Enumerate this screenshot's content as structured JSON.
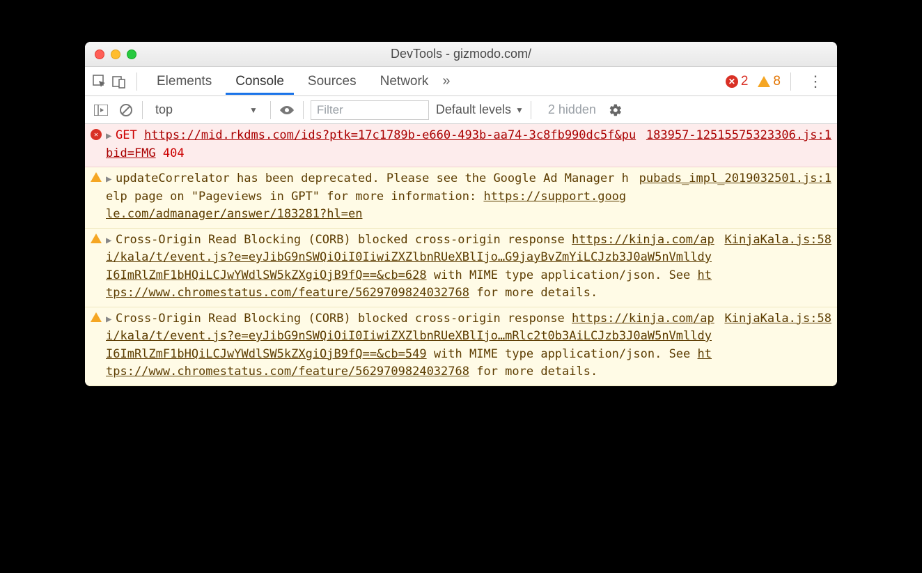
{
  "window": {
    "title": "DevTools - gizmodo.com/"
  },
  "tabs": {
    "items": [
      "Elements",
      "Console",
      "Sources",
      "Network"
    ],
    "active": 1,
    "error_count": "2",
    "warn_count": "8"
  },
  "filterbar": {
    "context": "top",
    "filter_placeholder": "Filter",
    "levels": "Default levels",
    "hidden": "2 hidden"
  },
  "messages": [
    {
      "type": "error",
      "source": "183957-12515575323306.js:1",
      "method": "GET",
      "url": "https://mid.rkdms.com/ids?ptk=17c1789b-e660-493b-aa74-3c8fb990dc5f&pubid=FMG",
      "status": "404"
    },
    {
      "type": "warn",
      "source": "pubads_impl_2019032501.js:1",
      "text_pre": "updateCorrelator has been deprecated. Please see the Google Ad Manager help page on \"Pageviews in GPT\" for more information: ",
      "link": "https://support.google.com/admanager/answer/183281?hl=en"
    },
    {
      "type": "warn",
      "source": "KinjaKala.js:58",
      "text_pre": "Cross-Origin Read Blocking (CORB) blocked cross-origin response ",
      "link": "https://kinja.com/api/kala/t/event.js?e=eyJibG9nSWQiOiI0IiwiZXZlbnRUeXBlIjo…G9jayBvZmYiLCJzb3J0aW5nVmlldyI6ImRlZmF1bHQiLCJwYWdlSW5kZXgiOjB9fQ==&cb=628",
      "text_mid": " with MIME type application/json. See ",
      "link2": "https://www.chromestatus.com/feature/5629709824032768",
      "text_post": " for more details."
    },
    {
      "type": "warn",
      "source": "KinjaKala.js:58",
      "text_pre": "Cross-Origin Read Blocking (CORB) blocked cross-origin response ",
      "link": "https://kinja.com/api/kala/t/event.js?e=eyJibG9nSWQiOiI0IiwiZXZlbnRUeXBlIjo…mRlc2t0b3AiLCJzb3J0aW5nVmlldyI6ImRlZmF1bHQiLCJwYWdlSW5kZXgiOjB9fQ==&cb=549",
      "text_mid": " with MIME type application/json. See ",
      "link2": "https://www.chromestatus.com/feature/5629709824032768",
      "text_post": " for more details."
    }
  ]
}
